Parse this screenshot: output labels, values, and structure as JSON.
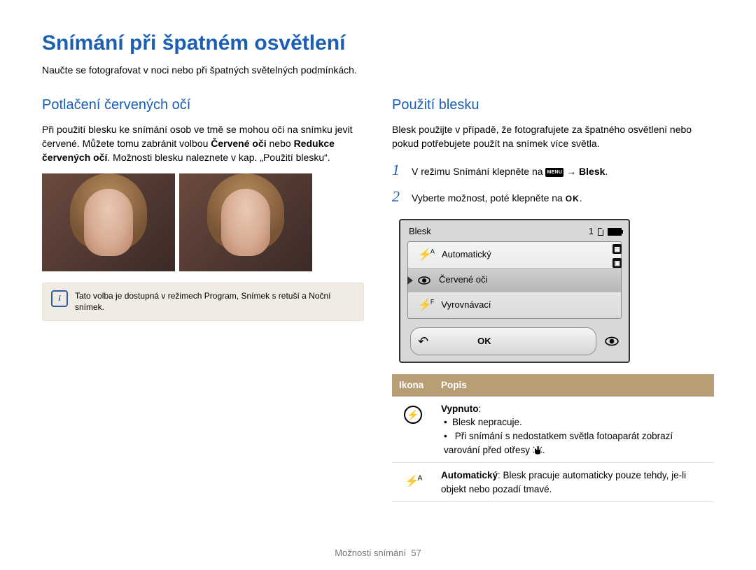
{
  "page": {
    "title": "Snímání při špatném osvětlení",
    "intro": "Naučte se fotografovat v noci nebo při špatných světelných podmínkách.",
    "footer_label": "Možnosti snímání",
    "footer_page": "57"
  },
  "left": {
    "heading": "Potlačení červených očí",
    "body_before_bold1": "Při použití blesku ke snímání osob ve tmě se mohou oči na snímku jevit červené. Můžete tomu zabránit volbou ",
    "bold1": "Červené oči",
    "body_mid": " nebo ",
    "bold2": "Redukce červených očí",
    "body_after": ". Možnosti blesku naleznete v kap. „Použití blesku“.",
    "note_text": "Tato volba je dostupná v režimech Program, Snímek s retuší a Noční snímek."
  },
  "right": {
    "heading": "Použití blesku",
    "lead": "Blesk použijte v případě, že fotografujete za špatného osvětlení nebo pokud potřebujete použít na snímek více světla.",
    "step1_pre": "V režimu Snímání klepněte na ",
    "step1_menu_glyph": "MENU",
    "step1_arrow": " → ",
    "step1_bold": "Blesk",
    "step1_post": ".",
    "step2_pre": "Vyberte možnost, poté klepněte na ",
    "step2_ok": "OK",
    "step2_post": "."
  },
  "lcd": {
    "title": "Blesk",
    "count": "1",
    "items": [
      {
        "icon": "flash-auto",
        "label": "Automatický"
      },
      {
        "icon": "eye",
        "label": "Červené oči"
      },
      {
        "icon": "flash-f",
        "label": "Vyrovnávací"
      }
    ],
    "ok": "OK"
  },
  "table": {
    "head_icon": "Ikona",
    "head_desc": "Popis",
    "rows": [
      {
        "icon": "flash-off",
        "title": "Vypnuto",
        "bullets": [
          "Blesk nepracuje.",
          "Při snímání s nedostatkem světla fotoaparát zobrazí varování před otřesy "
        ],
        "hand_after_bullet2": true
      },
      {
        "icon": "flash-auto",
        "title": "Automatický",
        "text_after_title": ": Blesk pracuje automaticky pouze tehdy, je-li objekt nebo pozadí tmavé."
      }
    ]
  }
}
